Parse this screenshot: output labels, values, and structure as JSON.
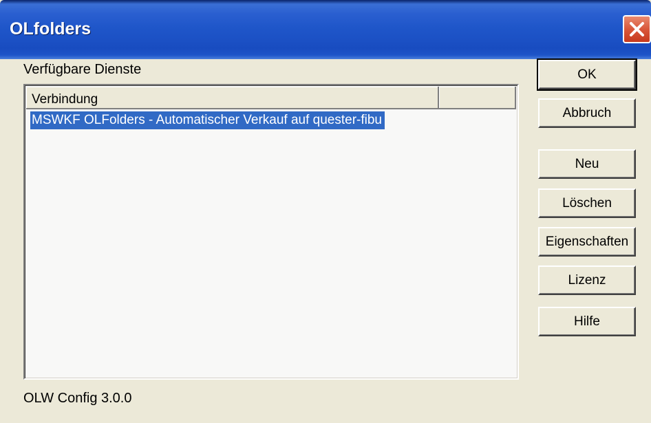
{
  "window": {
    "title": "OLfolders",
    "close_icon": "close-icon"
  },
  "main": {
    "available_services_label": "Verfügbare Dienste",
    "list": {
      "columns": [
        "Verbindung",
        ""
      ],
      "rows": [
        "MSWKF OLFolders - Automatischer Verkauf auf quester-fibu"
      ],
      "selected_index": 0
    },
    "status": "OLW Config 3.0.0"
  },
  "buttons": {
    "ok": "OK",
    "cancel": "Abbruch",
    "new": "Neu",
    "delete": "Löschen",
    "properties": "Eigenschaften",
    "license": "Lizenz",
    "help": "Hilfe"
  },
  "colors": {
    "titlebar": "#1d54c8",
    "selection": "#316ac5",
    "dialog_bg": "#ece9d8",
    "close_button": "#d9573a"
  }
}
